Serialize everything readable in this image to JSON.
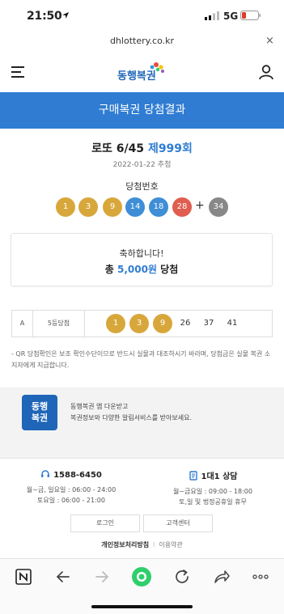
{
  "status_bar": {
    "time": "21:50",
    "network": "5G",
    "icons": [
      "location-arrow-icon",
      "signal-icon",
      "battery-icon"
    ]
  },
  "browser": {
    "url": "dhlottery.co.kr",
    "close": "×"
  },
  "header": {
    "menu_icon": "menu-icon",
    "logo_text": "동행복권",
    "user_icon": "user-icon"
  },
  "title": "구매복권 당첨결과",
  "draw": {
    "game": "로또 6/45",
    "round": "제999회",
    "date": "2022-01-22 추첨",
    "winning_label": "당첨번호",
    "numbers": [
      "1",
      "3",
      "9",
      "14",
      "18",
      "28"
    ],
    "plus": "+",
    "bonus": "34"
  },
  "result": {
    "congrats": "축하합니다!",
    "total_prefix": "총",
    "amount": "5,000원",
    "suffix": "당첨"
  },
  "ticket": {
    "slot": "A",
    "rank": "5등당첨",
    "numbers": [
      "1",
      "3",
      "9",
      "26",
      "37",
      "41"
    ]
  },
  "notice": "- QR 당첨확인은 보조 확인수단이므로 반드시 실물과 대조하시기 바라며, 당첨금은 실물 복권 소지자에게 지급합니다.",
  "promo": {
    "app_icon_line1": "동행",
    "app_icon_line2": "복권",
    "line1": "동행복권 앱 다운받고",
    "line2": "복권정보와 다양한 알림서비스를 받아보세요."
  },
  "footer": {
    "phone": "1588-6450",
    "phone_hours1": "월~금, 일요일 : 06:00 - 24:00",
    "phone_hours2": "토요일 : 06:00 - 21:00",
    "consult": "1대1 상담",
    "consult_hours1": "월~금요일 : 09:00 - 18:00",
    "consult_hours2": "토,일 및 법정공휴일 휴무",
    "login_button": "로그인",
    "support_button": "고객센터",
    "privacy_link": "개인정보처리방침",
    "terms_link": "이용약관",
    "separator": "l"
  },
  "colors": {
    "brand_blue": "#2f7cd2",
    "ball_yellow": "#d8a73b",
    "ball_blue": "#3f8ed6",
    "ball_red": "#df5e4f",
    "ball_gray": "#888888",
    "browser_green": "#2fcf6b"
  }
}
